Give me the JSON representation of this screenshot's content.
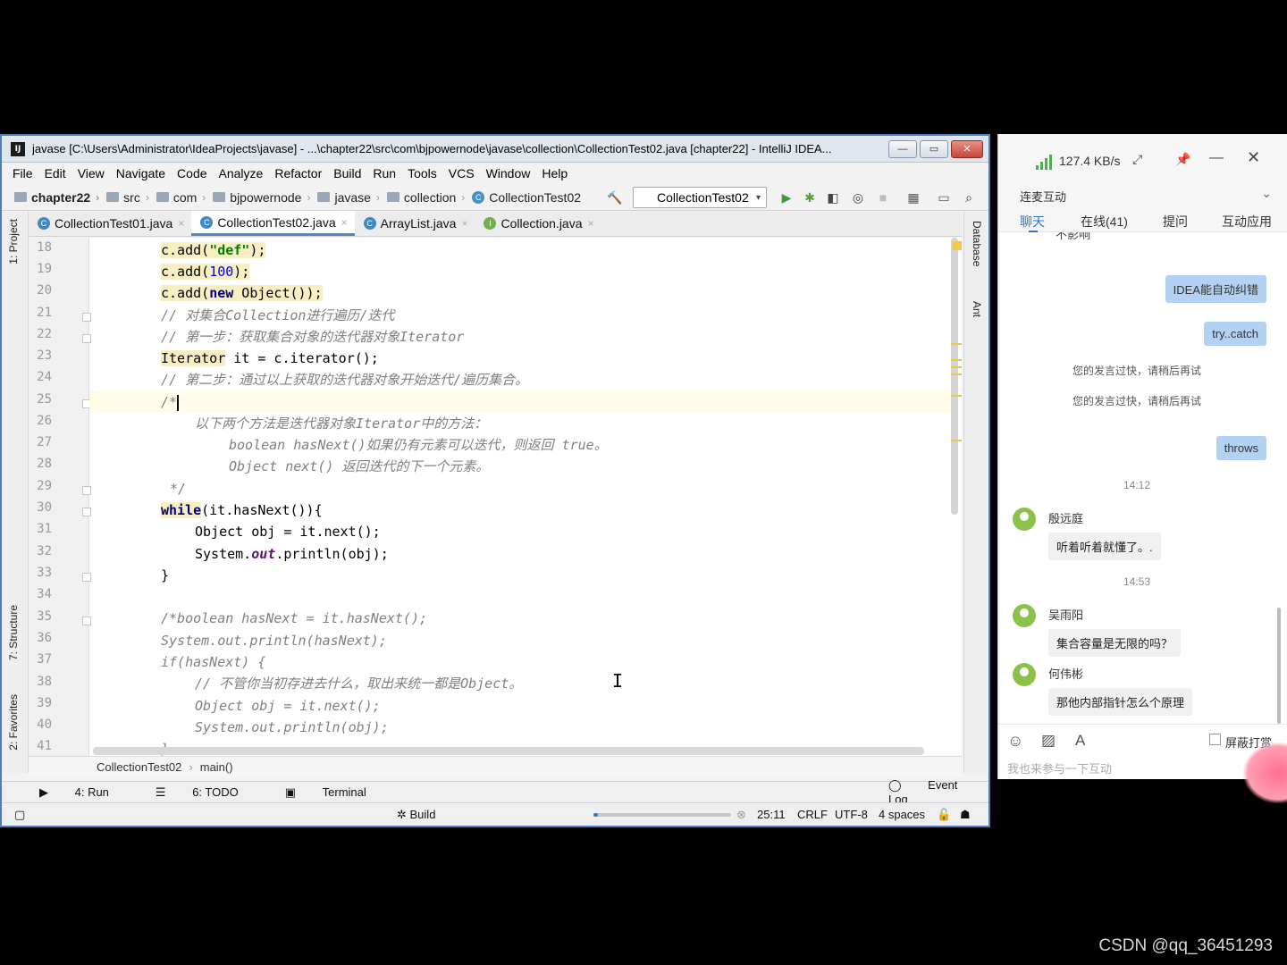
{
  "window": {
    "title": "javase [C:\\Users\\Administrator\\IdeaProjects\\javase] - ...\\chapter22\\src\\com\\bjpowernode\\javase\\collection\\CollectionTest02.java [chapter22] - IntelliJ IDEA...",
    "icon": "IJ"
  },
  "menu": [
    "File",
    "Edit",
    "View",
    "Navigate",
    "Code",
    "Analyze",
    "Refactor",
    "Build",
    "Run",
    "Tools",
    "VCS",
    "Window",
    "Help"
  ],
  "breadcrumbs": [
    "chapter22",
    "src",
    "com",
    "bjpowernode",
    "javase",
    "collection",
    "CollectionTest02"
  ],
  "run_config": "CollectionTest02",
  "left_tabs": [
    "1: Project",
    "7: Structure",
    "2: Favorites"
  ],
  "right_tabs": [
    "Database",
    "Ant"
  ],
  "tabs": [
    {
      "label": "CollectionTest01.java",
      "icon": "C"
    },
    {
      "label": "CollectionTest02.java",
      "icon": "C"
    },
    {
      "label": "ArrayList.java",
      "icon": "C"
    },
    {
      "label": "Collection.java",
      "icon": "I"
    }
  ],
  "line_numbers": [
    "18",
    "19",
    "20",
    "21",
    "22",
    "23",
    "24",
    "25",
    "26",
    "27",
    "28",
    "29",
    "30",
    "31",
    "32",
    "33",
    "34",
    "35",
    "36",
    "37",
    "38",
    "39",
    "40",
    "41"
  ],
  "code": {
    "l18a": "c.add(",
    "l18s": "\"def\"",
    "l18b": ");",
    "l19a": "c.add(",
    "l19n": "100",
    "l19b": ");",
    "l20a": "c.add(",
    "l20k": "new",
    "l20b": " Object());",
    "l21": "// 对集合Collection进行遍历/迭代",
    "l22": "// 第一步：获取集合对象的迭代器对象Iterator",
    "l23a": "Iterator",
    "l23b": " it = c.iterator();",
    "l24": "// 第二步：通过以上获取的迭代器对象开始迭代/遍历集合。",
    "l25": "/*",
    "l26": "以下两个方法是迭代器对象Iterator中的方法：",
    "l27": "boolean hasNext()如果仍有元素可以迭代，则返回 true。",
    "l28": "Object next() 返回迭代的下一个元素。",
    "l29": "*/",
    "l30a": "while",
    "l30b": "(it.hasNext()){",
    "l31": "Object obj = it.next();",
    "l32a": "System.",
    "l32f": "out",
    "l32b": ".println(obj);",
    "l33": "}",
    "l35": "/*boolean hasNext = it.hasNext();",
    "l36": "System.out.println(hasNext);",
    "l37": "if(hasNext) {",
    "l38": "// 不管你当初存进去什么，取出来统一都是Object。",
    "l39": "Object obj = it.next();",
    "l40": "System.out.println(obj);",
    "l41": "}"
  },
  "editor_breadcrumb": [
    "CollectionTest02",
    "main()"
  ],
  "tool_windows": [
    "4: Run",
    "6: TODO",
    "Terminal"
  ],
  "event_log": "Event Log",
  "status": {
    "build": "Build",
    "position": "25:11",
    "line_sep": "CRLF",
    "encoding": "UTF-8",
    "indent": "4 spaces",
    "build_progress": 0.03
  },
  "chat": {
    "speed": "127.4 KB/s",
    "channel": "连麦互动",
    "tabs": [
      "聊天",
      "在线(41)",
      "提问",
      "互动应用"
    ],
    "partial_top": "不影响",
    "messages_right": [
      "IDEA能自动纠错",
      "try..catch"
    ],
    "system_msgs": [
      "您的发言过快，请稍后再试",
      "您的发言过快，请稍后再试"
    ],
    "msg_throws": "throws",
    "time1": "14:12",
    "user1": "殷远庭",
    "text1": "听着听着就懂了。.",
    "time2": "14:53",
    "user2": "吴雨阳",
    "text2": "集合容量是无限的吗？",
    "user3": "何伟彬",
    "text3": "那他内部指针怎么个原理",
    "block_label": "屏蔽打赏",
    "input_placeholder": "我也来参与一下互动"
  },
  "watermark": "CSDN @qq_36451293",
  "colors": {
    "accent": "#4a88c7",
    "keyword": "#000080",
    "string": "#008000",
    "number": "#0000ff",
    "comment": "#808080"
  }
}
